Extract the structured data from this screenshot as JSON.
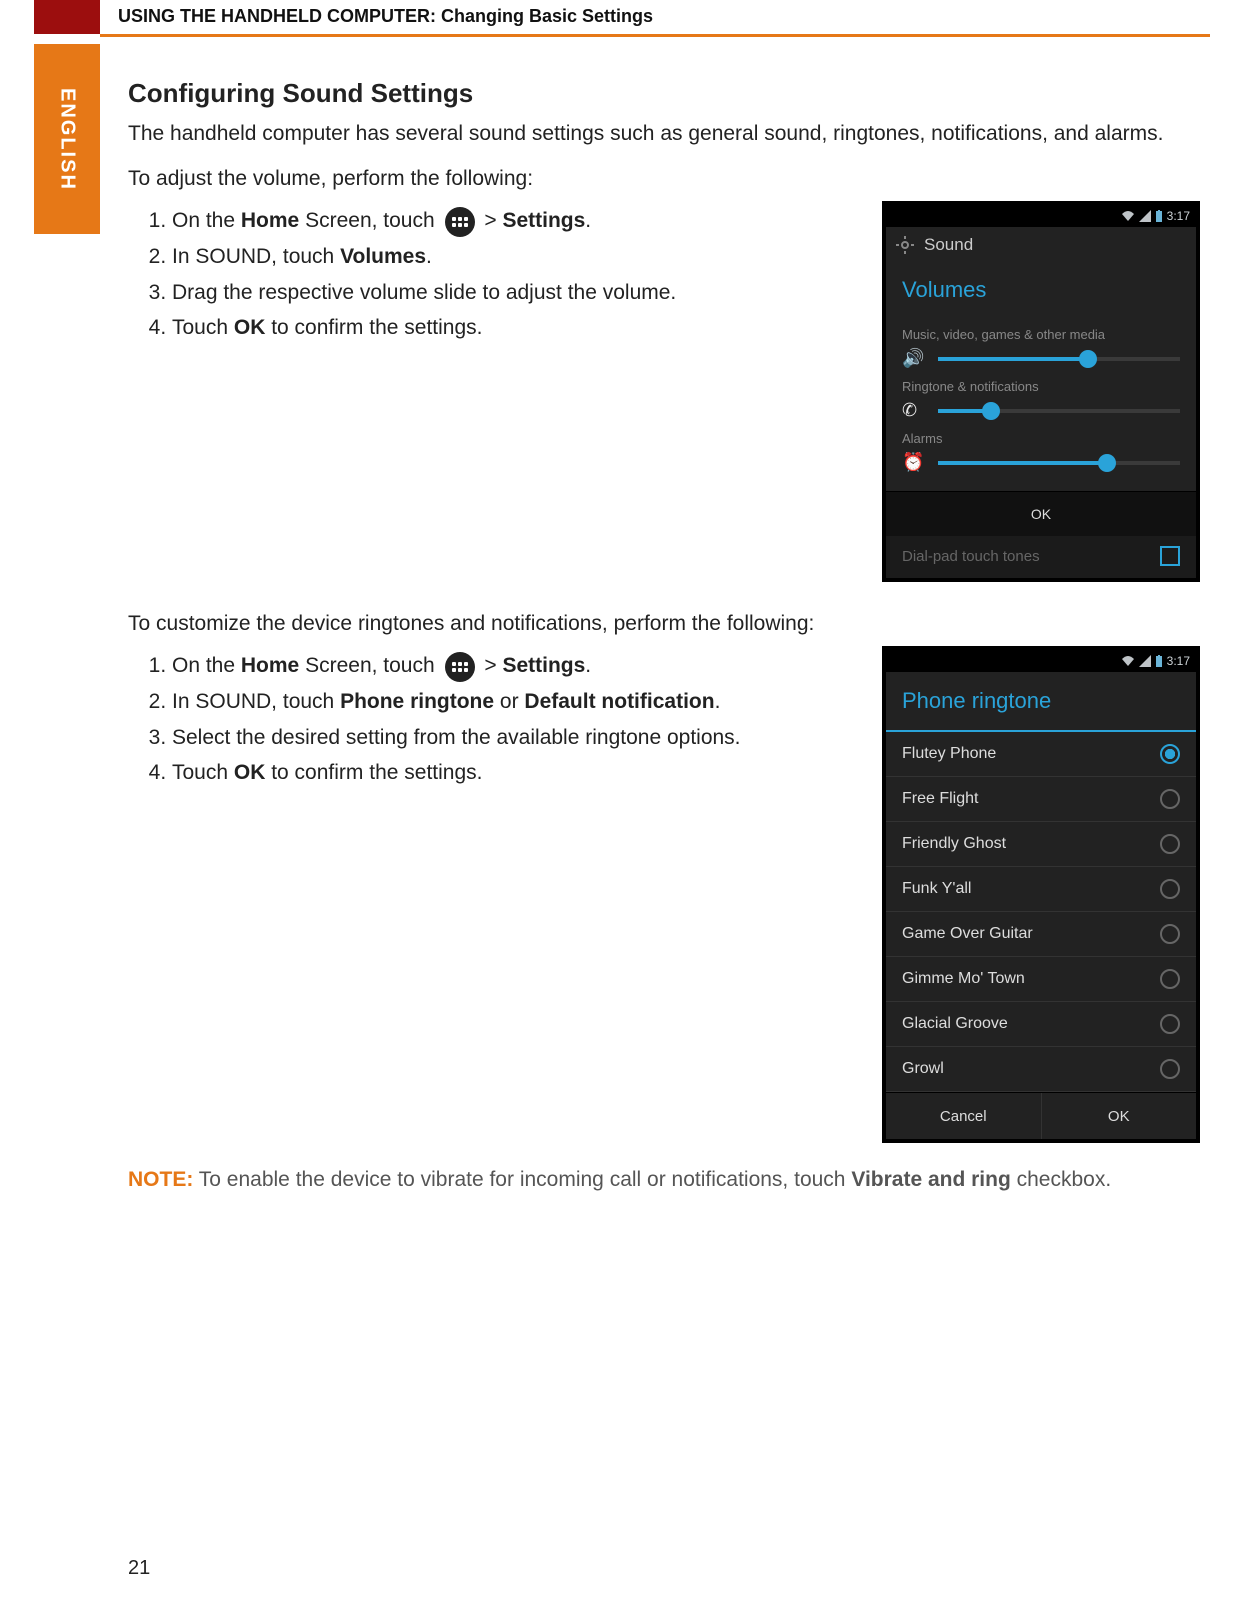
{
  "header": {
    "title": "USING THE HANDHELD COMPUTER: Changing Basic Settings",
    "language_tab": "ENGLISH"
  },
  "section": {
    "title": "Configuring Sound Settings",
    "intro": "The handheld computer has several sound settings such as general sound, ringtones, notifications, and alarms.",
    "volume_intro": "To adjust the volume, perform the following:",
    "steps_volume": {
      "s1_pre": "On the ",
      "s1_bold_home": "Home",
      "s1_mid": " Screen, touch ",
      "s1_gt": " > ",
      "s1_bold_settings": "Settings",
      "s1_end": ".",
      "s2_pre": "In SOUND, touch ",
      "s2_bold": "Volumes",
      "s2_end": ".",
      "s3": "Drag the respective volume slide to adjust the volume.",
      "s4_pre": "Touch ",
      "s4_bold": "OK",
      "s4_end": " to confirm the settings."
    },
    "ringtone_intro": "To customize the device ringtones and notifications, perform the following:",
    "steps_ringtone": {
      "s1_pre": "On the ",
      "s1_bold_home": "Home",
      "s1_mid": " Screen, touch ",
      "s1_gt": " > ",
      "s1_bold_settings": "Settings",
      "s1_end": ".",
      "s2_pre": "In SOUND, touch ",
      "s2_bold1": "Phone ringtone",
      "s2_or": " or ",
      "s2_bold2": "Default notification",
      "s2_end": ".",
      "s3": "Select the desired setting from the available ringtone options.",
      "s4_pre": "Touch ",
      "s4_bold": "OK",
      "s4_end": " to confirm the settings."
    }
  },
  "phone_volume": {
    "time": "3:17",
    "appbar": "Sound",
    "title": "Volumes",
    "sliders": {
      "media_label": "Music, video, games & other media",
      "ringtone_label": "Ringtone & notifications",
      "alarm_label": "Alarms"
    },
    "ok": "OK",
    "dialpad": "Dial-pad touch tones"
  },
  "phone_ringtone": {
    "time": "3:17",
    "title": "Phone ringtone",
    "options": [
      {
        "label": "Flutey Phone",
        "selected": true
      },
      {
        "label": "Free Flight",
        "selected": false
      },
      {
        "label": "Friendly Ghost",
        "selected": false
      },
      {
        "label": "Funk Y'all",
        "selected": false
      },
      {
        "label": "Game Over Guitar",
        "selected": false
      },
      {
        "label": "Gimme Mo' Town",
        "selected": false
      },
      {
        "label": "Glacial Groove",
        "selected": false
      },
      {
        "label": "Growl",
        "selected": false
      }
    ],
    "cancel": "Cancel",
    "ok": "OK"
  },
  "note": {
    "label": "NOTE:",
    "text_pre": " To enable the device to vibrate for incoming call or notifications, touch ",
    "bold": "Vibrate and ring",
    "text_post": " checkbox."
  },
  "page_number": "21"
}
